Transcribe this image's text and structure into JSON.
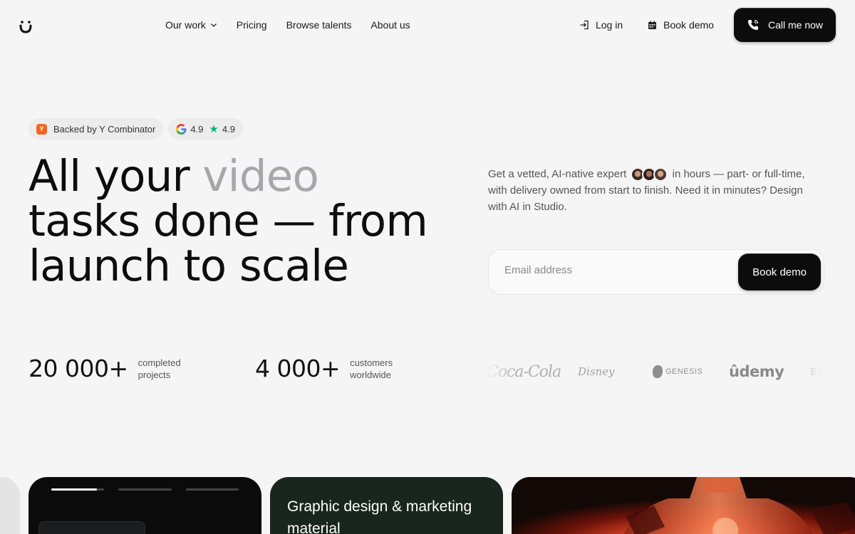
{
  "nav": {
    "items": [
      {
        "label": "Our work",
        "has_dropdown": true
      },
      {
        "label": "Pricing"
      },
      {
        "label": "Browse talents"
      },
      {
        "label": "About us"
      }
    ],
    "login": "Log in",
    "book_demo": "Book demo",
    "call": "Call me now"
  },
  "badges": {
    "yc_mark": "Y",
    "yc": "Backed by Y Combinator",
    "google_rating": "4.9",
    "trustpilot_rating": "4.9"
  },
  "hero": {
    "title_line1": "All your",
    "title_accent": "video",
    "title_rest": "tasks done — from launch to scale",
    "desc_before": "Get a vetted, AI-native expert",
    "desc_after": "in hours — part- or full-time, with delivery owned from start to finish. Need it in minutes? Design with AI in Studio.",
    "email_placeholder": "Email address",
    "cta": "Book demo"
  },
  "stats": [
    {
      "number": "20 000+",
      "label": "completed projects"
    },
    {
      "number": "4 000+",
      "label": "customers worldwide"
    }
  ],
  "clients": [
    "Coca-Cola",
    "Disney",
    "GENESIS",
    "ûdemy",
    "EY"
  ],
  "cards": {
    "card2_title": "Graphic design & marketing material"
  },
  "colors": {
    "accent_text": "#a7a7ab",
    "button_bg": "#0c0c0c",
    "yc_orange": "#f26522",
    "trustpilot_green": "#00b67a",
    "card2_bg": "#19261d"
  }
}
